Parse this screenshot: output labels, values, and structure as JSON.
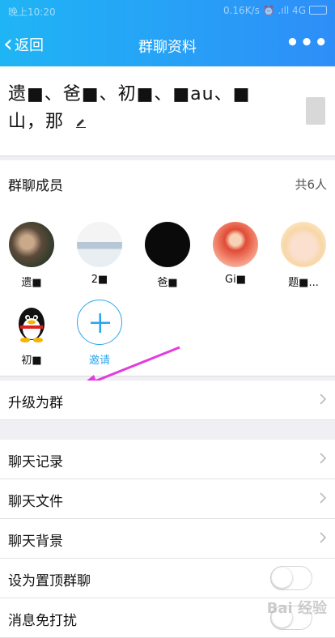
{
  "status_bar": {
    "time": "晚上10:20",
    "right": "0.16K/s ⏰ .ıll 4G"
  },
  "nav": {
    "back_label": "返回",
    "title": "群聊资料",
    "more_label": "•••"
  },
  "group": {
    "name": "遗■、爸■、初■、■au、■山，那"
  },
  "members": {
    "title": "群聊成员",
    "count": "共6人",
    "list": [
      {
        "name": "遗■"
      },
      {
        "name": "2■"
      },
      {
        "name": "爸■"
      },
      {
        "name": "Gi■"
      },
      {
        "name": "题■..."
      },
      {
        "name": "初■"
      }
    ],
    "invite_label": "邀请"
  },
  "upgrade": {
    "label": "升级为群"
  },
  "menu": {
    "chat_history": "聊天记录",
    "chat_files": "聊天文件",
    "chat_background": "聊天背景",
    "pin_chat": "设为置顶群聊",
    "mute": "消息免打扰"
  },
  "watermark": "Bai 经验",
  "colors": {
    "header_start": "#1fb5f5",
    "header_end": "#2e8ef8",
    "arrow": "#e43be0",
    "invite_accent": "#29a6ee"
  }
}
